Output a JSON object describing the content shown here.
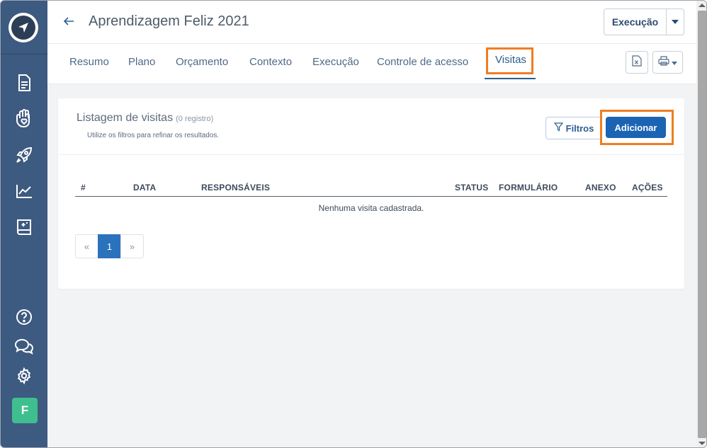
{
  "header": {
    "title": "Aprendizagem Feliz 2021",
    "status_button": "Execução"
  },
  "tabs": [
    {
      "label": "Resumo"
    },
    {
      "label": "Plano"
    },
    {
      "label": "Orçamento"
    },
    {
      "label": "Contexto"
    },
    {
      "label": "Execução"
    },
    {
      "label": "Controle de acesso"
    },
    {
      "label": "Visitas",
      "active": true
    }
  ],
  "sidebar": {
    "icons": [
      "compass-logo-icon",
      "document-icon",
      "hand-heart-icon",
      "rocket-icon",
      "chart-line-icon",
      "book-sparkle-icon",
      "help-icon",
      "chat-icon",
      "gear-icon"
    ],
    "avatar_letter": "F"
  },
  "card": {
    "title": "Listagem de visitas",
    "count": "(0 registro)",
    "subtitle": "Utilize os filtros para refinar os resultados.",
    "filter_label": "Filtros",
    "add_label": "Adicionar"
  },
  "table": {
    "columns": [
      "#",
      "DATA",
      "RESPONSÁVEIS",
      "STATUS",
      "FORMULÁRIO",
      "ANEXO",
      "AÇÕES"
    ],
    "empty_message": "Nenhuma visita cadastrada."
  },
  "pagination": {
    "prev": "«",
    "current": "1",
    "next": "»"
  },
  "colors": {
    "sidebar": "#3d5a80",
    "highlight": "#f07d22",
    "primary": "#1b64b3",
    "avatar": "#3fbf8f"
  }
}
